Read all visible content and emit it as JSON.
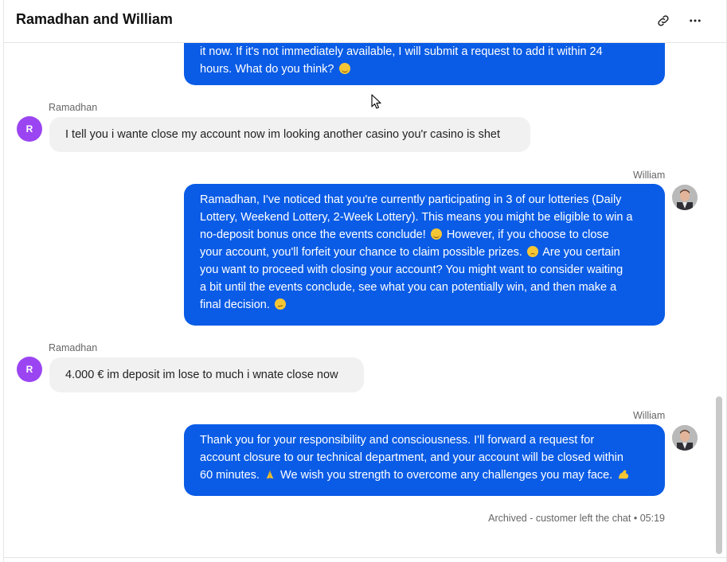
{
  "header": {
    "title": "Ramadhan and William",
    "link_icon": "link-icon",
    "more_icon": "more-horizontal-icon"
  },
  "messages": [
    {
      "sender": "William",
      "role": "agent",
      "lines": [
        "it now. If it's not immediately available, I will submit a request to add it within 24",
        "hours. What do you think?"
      ],
      "emoji": "smiling-sweat-emoji"
    },
    {
      "sender": "Ramadhan",
      "role": "customer",
      "avatar_initial": "R",
      "text": "I tell you i wante close my account now im looking another casino you'r casino is shet"
    },
    {
      "sender": "William",
      "role": "agent",
      "lines": [
        "Ramadhan, I've noticed that you're currently participating in 3 of our lotteries (Daily",
        "Lottery, Weekend Lottery, 2-Week Lottery). This means you might be eligible to win a",
        "no-deposit bonus once the events conclude!",
        "However, if you choose to close",
        "your account, you'll forfeit your chance to claim possible prizes.",
        "Are you certain",
        "you want to proceed with closing your account? You might want to consider waiting",
        "a bit until the events conclude, see what you can potentially win, and then make a",
        "final decision."
      ]
    },
    {
      "sender": "Ramadhan",
      "role": "customer",
      "avatar_initial": "R",
      "text": "4.000 € im deposit im lose to much i wnate close now"
    },
    {
      "sender": "William",
      "role": "agent",
      "lines": [
        "Thank you for your responsibility and consciousness. I'll forward a request for",
        "account closure to our technical department, and your account will be closed within",
        "60 minutes.",
        "We wish you strength to overcome any challenges you may face."
      ]
    }
  ],
  "status": {
    "text": "Archived - customer left the chat",
    "separator": "•",
    "time": "05:19"
  },
  "colors": {
    "agent_bubble": "#0a5ce6",
    "customer_bubble": "#f1f1f1",
    "customer_avatar": "#9b45f2"
  }
}
